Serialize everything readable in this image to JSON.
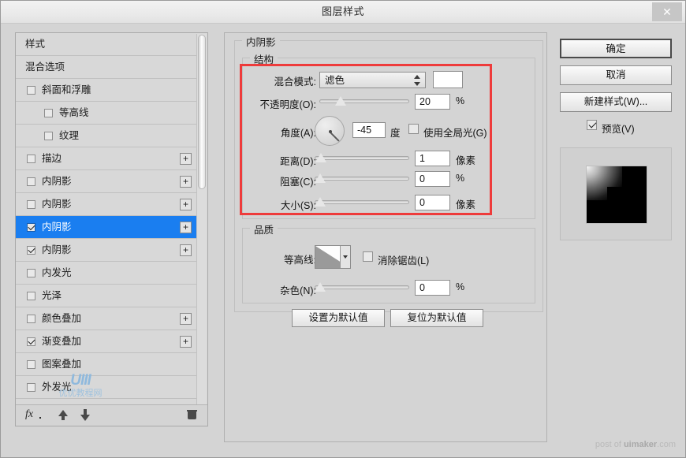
{
  "window": {
    "title": "图层样式",
    "close_label": "✕"
  },
  "sidebar": {
    "items": [
      {
        "label": "样式",
        "type": "plain",
        "checkbox": null,
        "plus": false,
        "selected": false,
        "indent": 0
      },
      {
        "label": "混合选项",
        "type": "plain",
        "checkbox": null,
        "plus": false,
        "selected": false,
        "indent": 0
      },
      {
        "label": "斜面和浮雕",
        "type": "check",
        "checkbox": false,
        "plus": false,
        "selected": false,
        "indent": 0
      },
      {
        "label": "等高线",
        "type": "check",
        "checkbox": false,
        "plus": false,
        "selected": false,
        "indent": 1
      },
      {
        "label": "纹理",
        "type": "check",
        "checkbox": false,
        "plus": false,
        "selected": false,
        "indent": 1
      },
      {
        "label": "描边",
        "type": "check",
        "checkbox": false,
        "plus": true,
        "selected": false,
        "indent": 0
      },
      {
        "label": "内阴影",
        "type": "check",
        "checkbox": false,
        "plus": true,
        "selected": false,
        "indent": 0
      },
      {
        "label": "内阴影",
        "type": "check",
        "checkbox": false,
        "plus": true,
        "selected": false,
        "indent": 0
      },
      {
        "label": "内阴影",
        "type": "check",
        "checkbox": true,
        "plus": true,
        "selected": true,
        "indent": 0
      },
      {
        "label": "内阴影",
        "type": "check",
        "checkbox": true,
        "plus": true,
        "selected": false,
        "indent": 0
      },
      {
        "label": "内发光",
        "type": "check",
        "checkbox": false,
        "plus": false,
        "selected": false,
        "indent": 0
      },
      {
        "label": "光泽",
        "type": "check",
        "checkbox": false,
        "plus": false,
        "selected": false,
        "indent": 0
      },
      {
        "label": "颜色叠加",
        "type": "check",
        "checkbox": false,
        "plus": true,
        "selected": false,
        "indent": 0
      },
      {
        "label": "渐变叠加",
        "type": "check",
        "checkbox": true,
        "plus": true,
        "selected": false,
        "indent": 0
      },
      {
        "label": "图案叠加",
        "type": "check",
        "checkbox": false,
        "plus": false,
        "selected": false,
        "indent": 0
      },
      {
        "label": "外发光",
        "type": "check",
        "checkbox": false,
        "plus": false,
        "selected": false,
        "indent": 0
      }
    ],
    "plus_label": "+",
    "footer": {
      "fx_label": "fx",
      "move_up_name": "move-up-arrow",
      "move_down_name": "move-down-arrow",
      "delete_name": "delete-effect"
    },
    "watermark": {
      "logo": "UIII",
      "sub": "优优教程网"
    }
  },
  "main": {
    "section_title": "内阴影",
    "structure": {
      "title": "结构",
      "blend_mode": {
        "label": "混合模式:",
        "value": "滤色",
        "color_swatch": "#ffffff"
      },
      "opacity": {
        "label": "不透明度(O):",
        "value": "20",
        "unit": "%",
        "slider_percent": 20
      },
      "angle": {
        "label": "角度(A):",
        "value": "-45",
        "unit": "度",
        "dial_degrees": -45,
        "use_global_light": {
          "label": "使用全局光(G)",
          "checked": false
        }
      },
      "distance": {
        "label": "距离(D):",
        "value": "1",
        "unit": "像素",
        "slider_percent": 1
      },
      "choke": {
        "label": "阻塞(C):",
        "value": "0",
        "unit": "%",
        "slider_percent": 0
      },
      "size": {
        "label": "大小(S):",
        "value": "0",
        "unit": "像素",
        "slider_percent": 0
      }
    },
    "quality": {
      "title": "品质",
      "contour": {
        "label": "等高线:",
        "anti_alias": {
          "label": "消除锯齿(L)",
          "checked": false
        }
      },
      "noise": {
        "label": "杂色(N):",
        "value": "0",
        "unit": "%",
        "slider_percent": 0
      }
    },
    "footer_buttons": {
      "set_default": "设置为默认值",
      "reset_default": "复位为默认值"
    }
  },
  "right_panel": {
    "ok": "确定",
    "cancel": "取消",
    "new_style": "新建样式(W)...",
    "preview": {
      "label": "预览(V)",
      "checked": true
    }
  },
  "footer_note": {
    "prefix": "post of ",
    "brand": "uimaker",
    "suffix": ".com"
  },
  "colors": {
    "accent_selected": "#1a7ef0",
    "highlight_box": "#ee3b3b",
    "dialog_bg": "#d4d4d4"
  }
}
